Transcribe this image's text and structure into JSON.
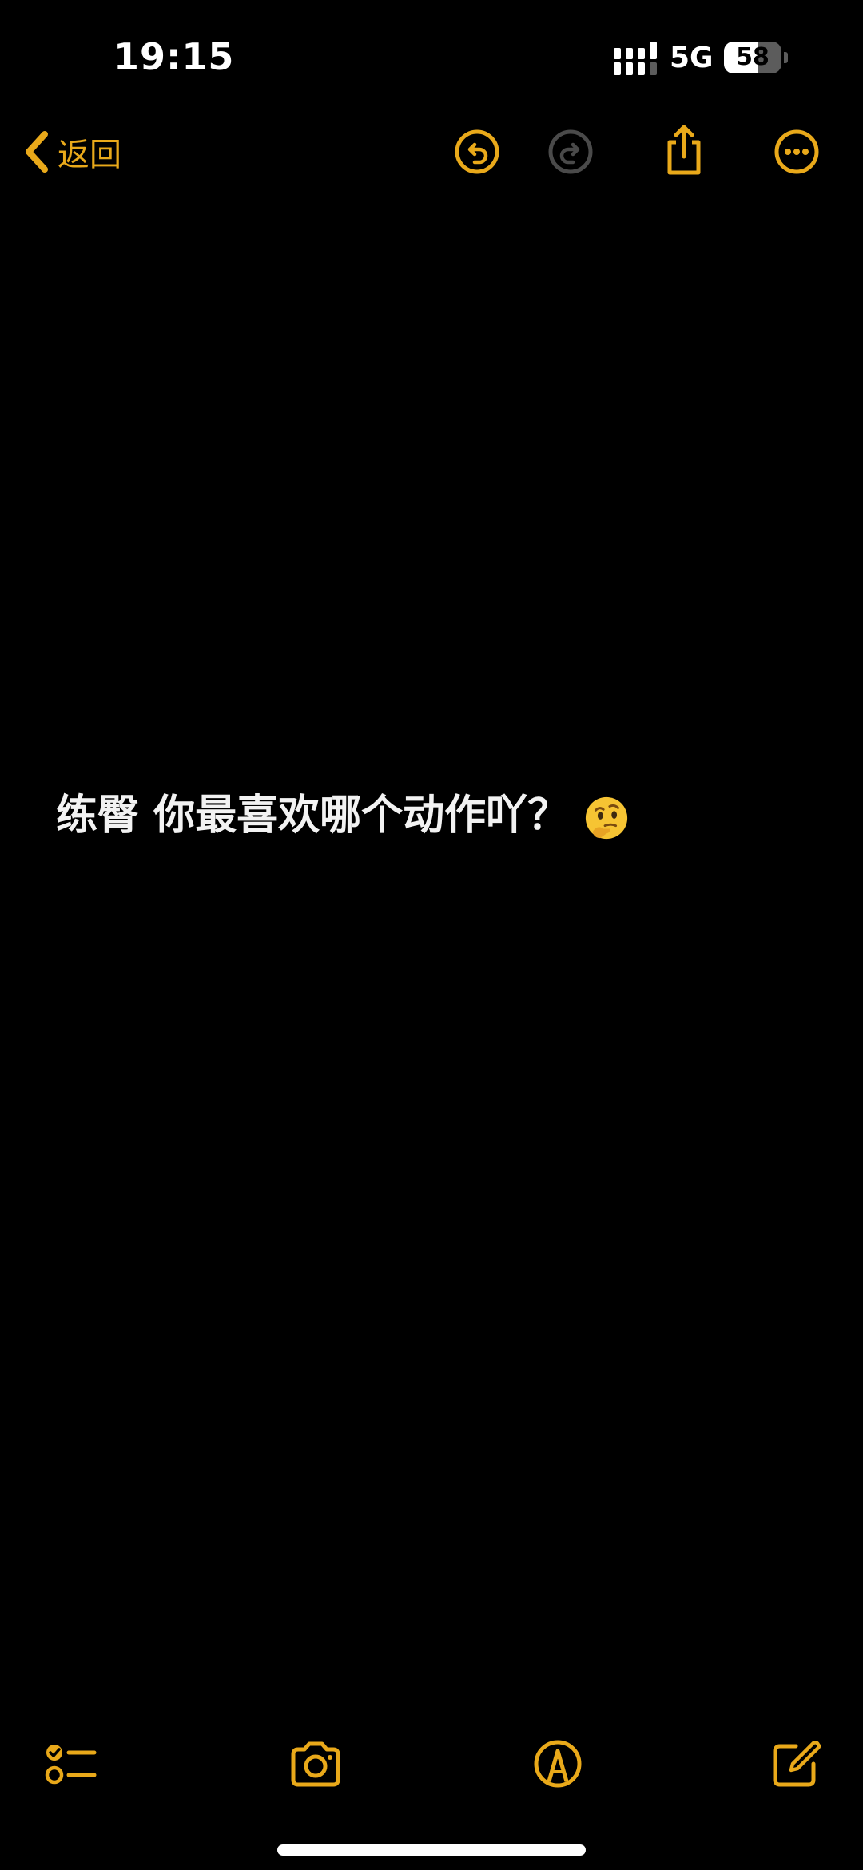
{
  "status_bar": {
    "time": "19:15",
    "network": "5G",
    "battery": "58",
    "battery_level": 0.58
  },
  "nav": {
    "back_label": "返回"
  },
  "note": {
    "text": "练臀 你最喜欢哪个动作吖？"
  },
  "icons": {
    "back": "chevron-left-icon",
    "undo": "undo-icon",
    "redo": "redo-icon",
    "share": "share-icon",
    "more": "more-icon",
    "checklist": "checklist-icon",
    "camera": "camera-icon",
    "markup": "markup-pen-icon",
    "compose": "compose-icon",
    "emoji": "thinking-face-emoji"
  },
  "colors": {
    "accent": "#e9a91a",
    "disabled": "#4a4a4a",
    "background": "#000000",
    "text": "#f2f2f2"
  }
}
